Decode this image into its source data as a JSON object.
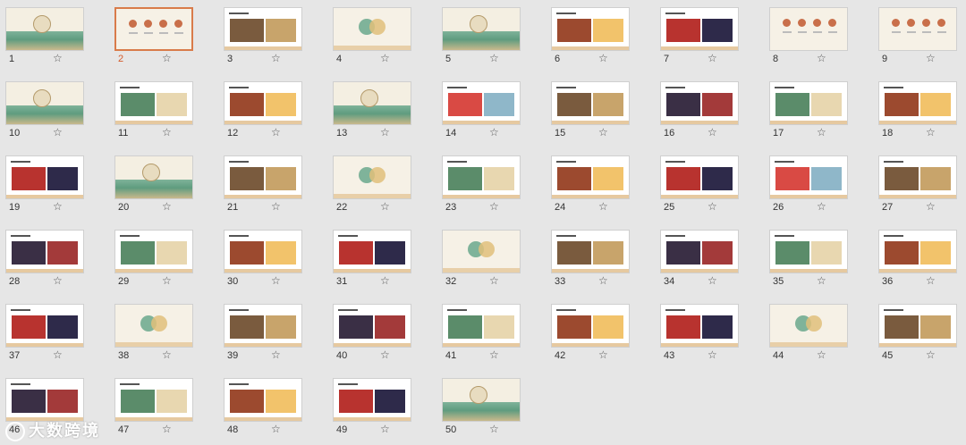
{
  "slides": [
    {
      "num": "1",
      "type": "title"
    },
    {
      "num": "2",
      "type": "toc"
    },
    {
      "num": "3",
      "type": "text-photo"
    },
    {
      "num": "4",
      "type": "circle"
    },
    {
      "num": "5",
      "type": "section"
    },
    {
      "num": "6",
      "type": "text-photo"
    },
    {
      "num": "7",
      "type": "text-photo"
    },
    {
      "num": "8",
      "type": "icons"
    },
    {
      "num": "9",
      "type": "panels"
    },
    {
      "num": "10",
      "type": "section"
    },
    {
      "num": "11",
      "type": "text-photo"
    },
    {
      "num": "12",
      "type": "text-photo"
    },
    {
      "num": "13",
      "type": "section"
    },
    {
      "num": "14",
      "type": "photo"
    },
    {
      "num": "15",
      "type": "photo"
    },
    {
      "num": "16",
      "type": "photo"
    },
    {
      "num": "17",
      "type": "photo"
    },
    {
      "num": "18",
      "type": "photo"
    },
    {
      "num": "19",
      "type": "photo"
    },
    {
      "num": "20",
      "type": "section"
    },
    {
      "num": "21",
      "type": "photo"
    },
    {
      "num": "22",
      "type": "circle"
    },
    {
      "num": "23",
      "type": "photo"
    },
    {
      "num": "24",
      "type": "photo"
    },
    {
      "num": "25",
      "type": "photo"
    },
    {
      "num": "26",
      "type": "photo"
    },
    {
      "num": "27",
      "type": "photo"
    },
    {
      "num": "28",
      "type": "photo"
    },
    {
      "num": "29",
      "type": "photo"
    },
    {
      "num": "30",
      "type": "photo"
    },
    {
      "num": "31",
      "type": "photo"
    },
    {
      "num": "32",
      "type": "circle"
    },
    {
      "num": "33",
      "type": "photo"
    },
    {
      "num": "34",
      "type": "photo"
    },
    {
      "num": "35",
      "type": "photo"
    },
    {
      "num": "36",
      "type": "photo"
    },
    {
      "num": "37",
      "type": "photo"
    },
    {
      "num": "38",
      "type": "circle"
    },
    {
      "num": "39",
      "type": "photo"
    },
    {
      "num": "40",
      "type": "photo"
    },
    {
      "num": "41",
      "type": "photo"
    },
    {
      "num": "42",
      "type": "photo"
    },
    {
      "num": "43",
      "type": "photo"
    },
    {
      "num": "44",
      "type": "circle"
    },
    {
      "num": "45",
      "type": "photo"
    },
    {
      "num": "46",
      "type": "photo"
    },
    {
      "num": "47",
      "type": "photo"
    },
    {
      "num": "48",
      "type": "photo"
    },
    {
      "num": "49",
      "type": "photo"
    },
    {
      "num": "50",
      "type": "end"
    }
  ],
  "selected_slide": "2",
  "star_icon": "☆",
  "watermark": "大数跨境",
  "colors": {
    "selected_border": "#d97b4a",
    "selected_number": "#d45a2a"
  }
}
